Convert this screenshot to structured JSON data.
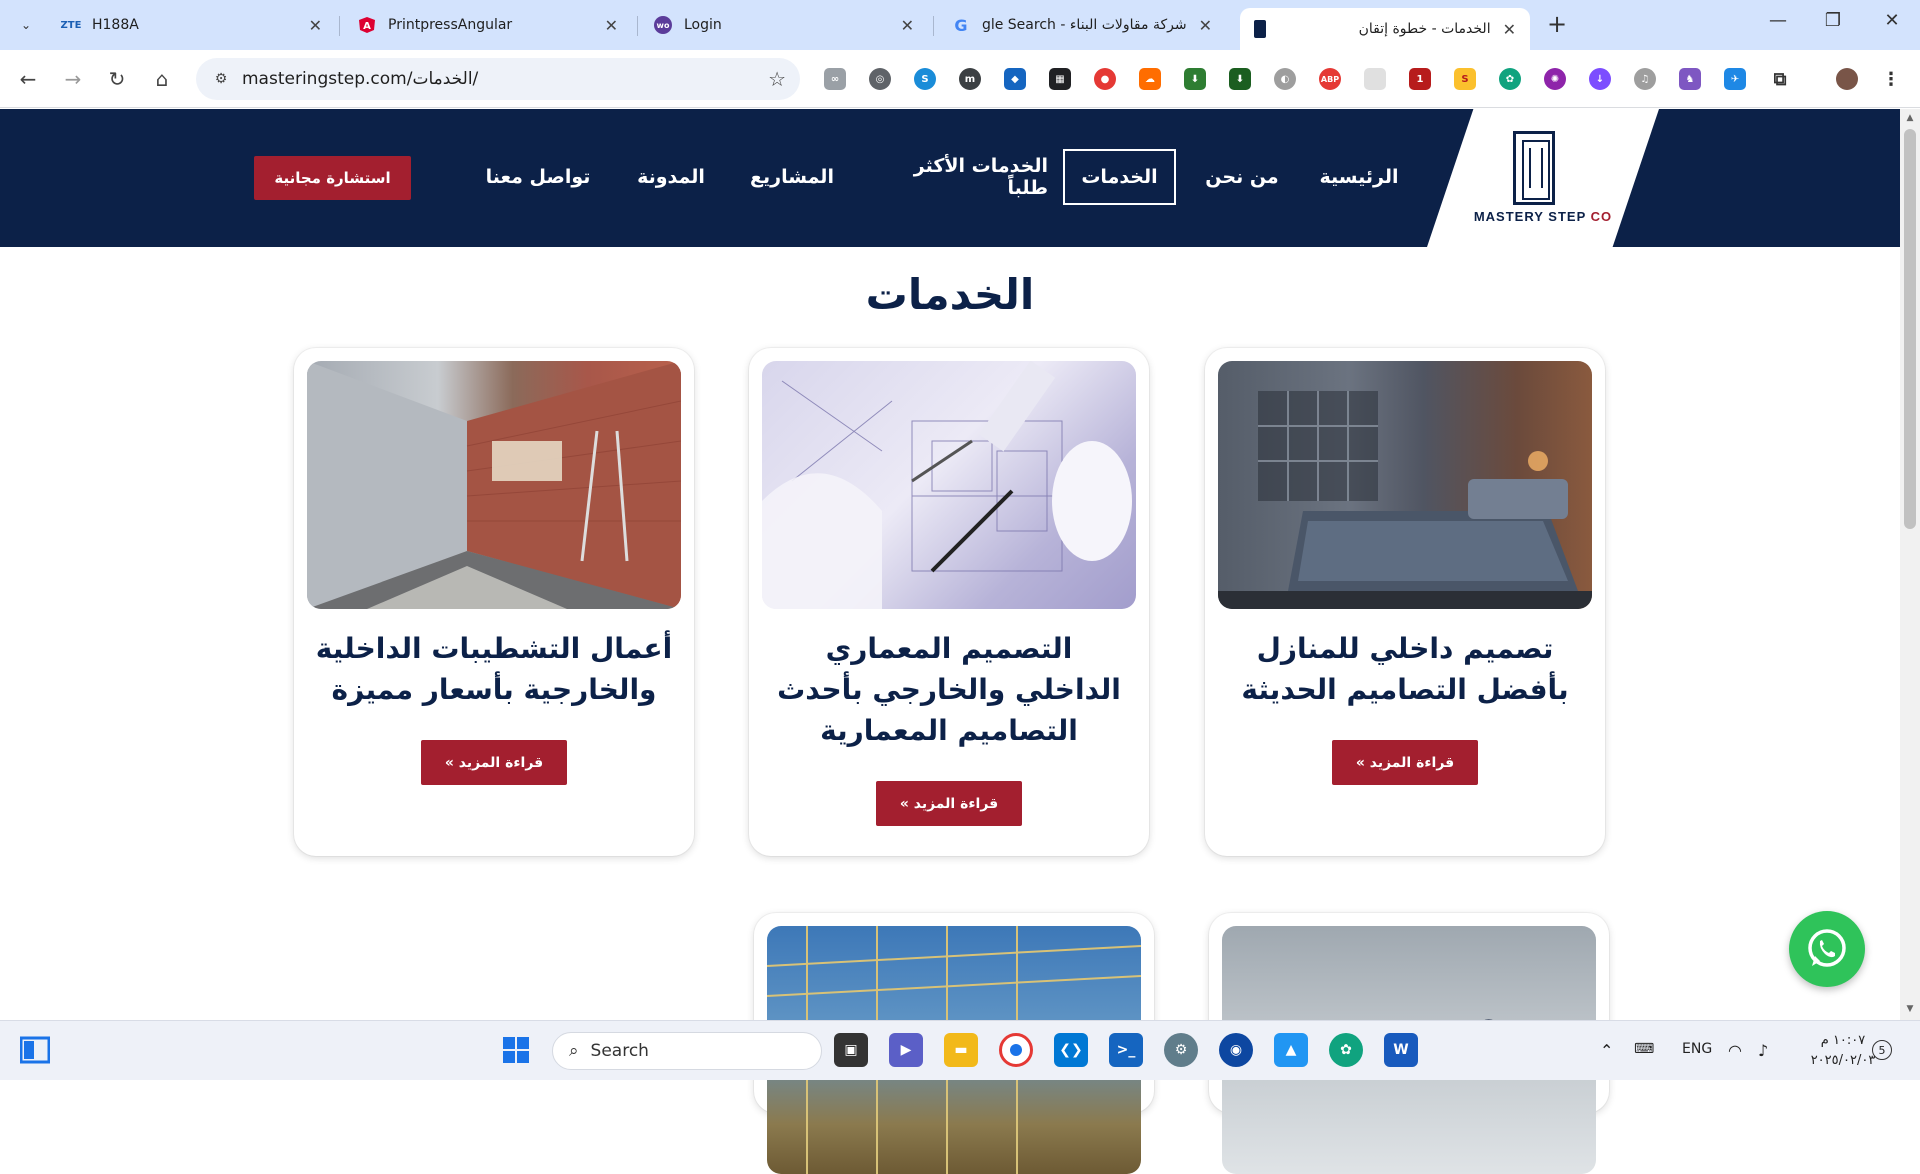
{
  "browser": {
    "tabs": [
      {
        "title": "H188A",
        "favicon": "ZTE",
        "favicon_color": "#1a5fb4",
        "active": false
      },
      {
        "title": "PrintpressAngular",
        "favicon": "angular-icon",
        "favicon_color": "#dd0031",
        "active": false
      },
      {
        "title": "Login",
        "favicon": "wo",
        "favicon_color": "#5b3c9a",
        "active": false
      },
      {
        "title": "شركة مقاولات البناء - Google Search",
        "favicon": "G",
        "favicon_color": "#4285f4",
        "active": false
      },
      {
        "title": "الخدمات - خطوة إتقان",
        "favicon": "site-icon",
        "favicon_color": "#0c2148",
        "active": true
      }
    ],
    "address": {
      "url": "masteringstep.com/الخدمات/"
    }
  },
  "site": {
    "logo": {
      "main": "MASTERY STEP",
      "accent": "CO"
    },
    "nav": [
      {
        "label": "الرئيسية",
        "active": false
      },
      {
        "label": "من نحن",
        "active": false
      },
      {
        "label": "الخدمات",
        "active": true
      },
      {
        "label": "الخدمات الأكثر طلباً",
        "active": false
      },
      {
        "label": "المشاريع",
        "active": false
      },
      {
        "label": "المدونة",
        "active": false
      },
      {
        "label": "تواصل معنا",
        "active": false
      }
    ],
    "cta": "استشارة مجانية",
    "page_title": "الخدمات",
    "read_more": "قراءة المزيد »",
    "cards": [
      {
        "title": "تصميم داخلي للمنازل بأفضل التصاميم الحديثة",
        "image": "bedroom"
      },
      {
        "title": "التصميم المعماري الداخلي والخارجي بأحدث التصاميم المعمارية",
        "image": "blueprint"
      },
      {
        "title": "أعمال التشطيبات الداخلية والخارجية بأسعار مميزة",
        "image": "plaster"
      }
    ]
  },
  "taskbar": {
    "search_placeholder": "Search",
    "language": "ENG",
    "time": "١٠:٠٧ م",
    "date": "٢٠٢٥/٠٢/٠٣",
    "notifications": "5"
  },
  "colors": {
    "brand_navy": "#0c2148",
    "brand_red": "#a31f2f",
    "whatsapp_green": "#2fc35a"
  }
}
